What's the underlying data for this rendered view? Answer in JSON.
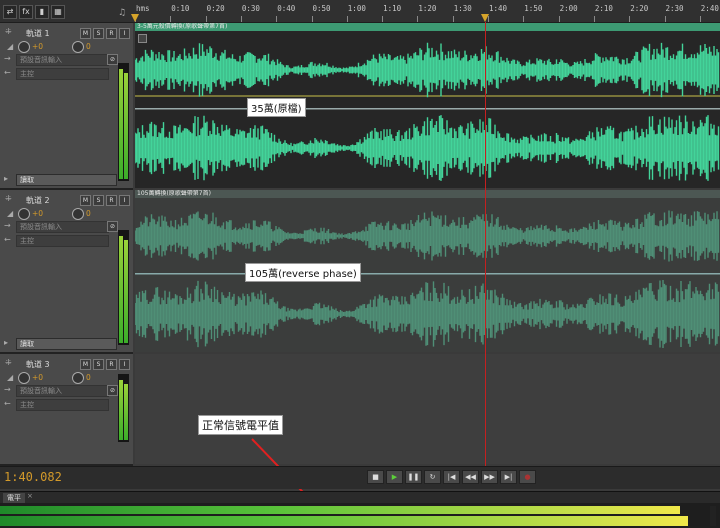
{
  "toolbar": {
    "icons": [
      "switch-icon",
      "fx-icon",
      "bars-icon",
      "grid-icon"
    ]
  },
  "ruler": {
    "ticks": [
      "hms",
      "0:10",
      "0:20",
      "0:30",
      "0:40",
      "0:50",
      "1:00",
      "1:10",
      "1:20",
      "1:30",
      "1:40",
      "1:50",
      "2:00",
      "2:10",
      "2:20",
      "2:30",
      "2:40"
    ]
  },
  "tracks": [
    {
      "name": "軌道 1",
      "volume": "+0",
      "pan": "0",
      "input": "預設音訊輸入",
      "output": "主控",
      "mode": "讀取",
      "clip_title": "3-5萬元殺價轉換(原歌聲帶第7首)",
      "label": "35萬(原檔)"
    },
    {
      "name": "軌道 2",
      "volume": "+0",
      "pan": "0",
      "input": "預設音訊輸入",
      "output": "主控",
      "mode": "讀取",
      "clip_title": "105萬轉換(原歌聲帶第7首)",
      "label": "105萬(reverse phase)"
    },
    {
      "name": "軌道 3",
      "volume": "+0",
      "pan": "0",
      "input": "預設音訊輸入",
      "output": "主控",
      "mode": "",
      "clip_title": "",
      "label": ""
    }
  ],
  "annotation": {
    "text": "正常信號電平值"
  },
  "transport": {
    "time": "1:40.082",
    "buttons": [
      "stop",
      "play",
      "pause",
      "loop",
      "to-start",
      "rewind",
      "forward",
      "to-end",
      "record"
    ]
  },
  "levels_panel": {
    "tab": "電平"
  },
  "colors": {
    "wave": "#43d49a",
    "wave_dim": "#4f8f76",
    "clip_bg": "#262626",
    "playhead": "#c42020"
  }
}
